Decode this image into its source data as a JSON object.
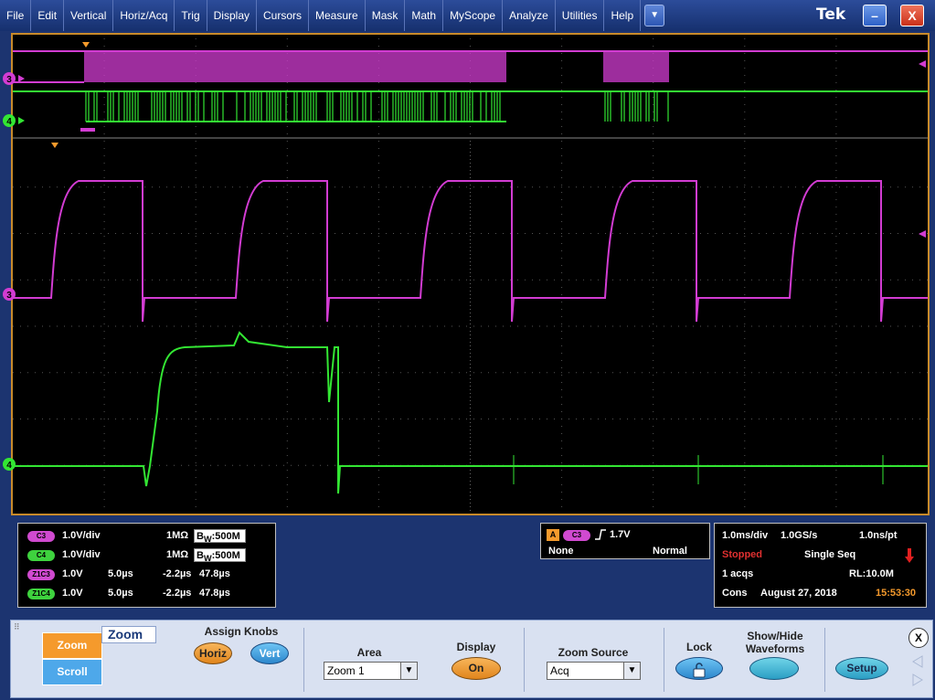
{
  "menu": {
    "items": [
      "File",
      "Edit",
      "Vertical",
      "Horiz/Acq",
      "Trig",
      "Display",
      "Cursors",
      "Measure",
      "Mask",
      "Math",
      "MyScope",
      "Analyze",
      "Utilities",
      "Help"
    ],
    "brand": "Tek",
    "minimize": "–",
    "close": "X"
  },
  "markers": {
    "ch3": "3",
    "ch4": "4"
  },
  "colors": {
    "ch3": "#d23cd2",
    "ch4": "#33e633",
    "frame": "#c88a2a"
  },
  "channels": [
    {
      "badge": "C3",
      "scale": "1.0V/div",
      "impedance": "1MΩ",
      "bw_prefix": "B",
      "bw_sub": "W",
      "bw": ":500M"
    },
    {
      "badge": "C4",
      "scale": "1.0V/div",
      "impedance": "1MΩ",
      "bw_prefix": "B",
      "bw_sub": "W",
      "bw": ":500M"
    }
  ],
  "zooms": [
    {
      "badge": "Z1C3",
      "scale": "1.0V",
      "time": "5.0µs",
      "offset": "-2.2µs",
      "position": "47.8µs"
    },
    {
      "badge": "Z1C4",
      "scale": "1.0V",
      "time": "5.0µs",
      "offset": "-2.2µs",
      "position": "47.8µs"
    }
  ],
  "trigger": {
    "badge_a": "A",
    "source": "C3",
    "level": "1.7V",
    "coupling": "None",
    "mode": "Normal"
  },
  "horizontal": {
    "scale": "1.0ms/div",
    "rate": "1.0GS/s",
    "resolution": "1.0ns/pt",
    "status": "Stopped",
    "acq_mode": "Single Seq",
    "acqs": "1 acqs",
    "record_length": "RL:10.0M",
    "cons": "Cons",
    "date": "August 27, 2018",
    "time": "15:53:30"
  },
  "control": {
    "zoom_tab": "Zoom",
    "scroll_tab": "Scroll",
    "title": "Zoom",
    "assign_knobs": "Assign Knobs",
    "horiz": "Horiz",
    "vert": "Vert",
    "area_label": "Area",
    "area_value": "Zoom 1",
    "display_label": "Display",
    "display_value": "On",
    "zoom_source_label": "Zoom Source",
    "zoom_source_value": "Acq",
    "lock_label": "Lock",
    "show_hide": "Show/Hide",
    "waveforms": "Waveforms",
    "setup": "Setup",
    "close": "X"
  }
}
